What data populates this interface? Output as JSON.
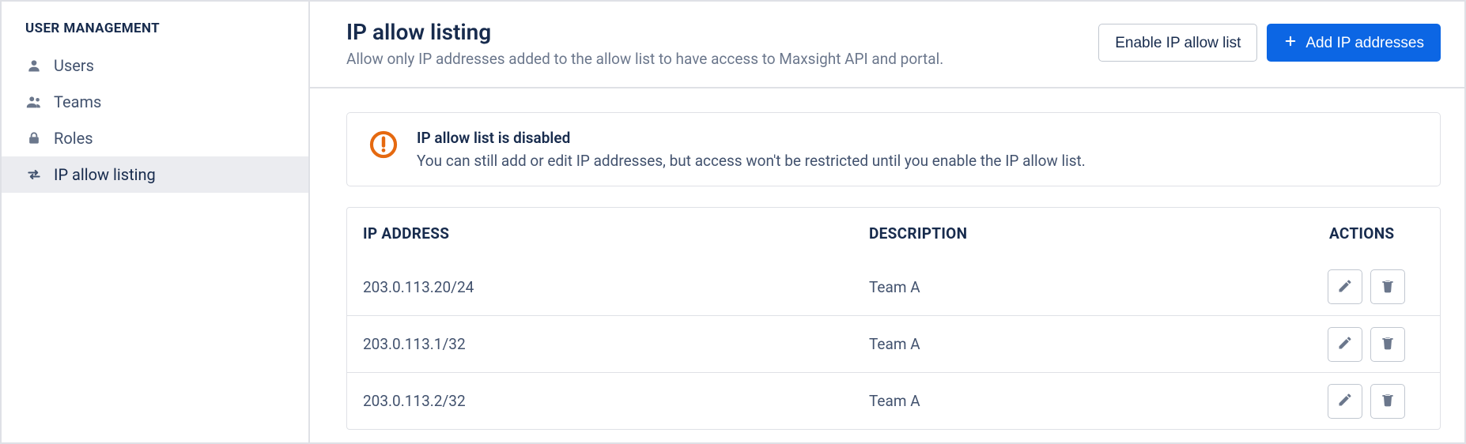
{
  "sidebar": {
    "title": "USER MANAGEMENT",
    "items": [
      {
        "label": "Users",
        "icon": "user"
      },
      {
        "label": "Teams",
        "icon": "team"
      },
      {
        "label": "Roles",
        "icon": "lock"
      },
      {
        "label": "IP allow listing",
        "icon": "swap"
      }
    ],
    "active_index": 3
  },
  "header": {
    "title": "IP allow listing",
    "subtitle": "Allow only IP addresses added to the allow list to have access to Maxsight API and portal.",
    "enable_button": "Enable IP allow list",
    "add_button": "Add IP addresses"
  },
  "alert": {
    "title": "IP allow list is disabled",
    "body": "You can still add or edit IP addresses, but access won't be restricted until you enable the IP allow list."
  },
  "table": {
    "columns": {
      "ip": "IP ADDRESS",
      "desc": "DESCRIPTION",
      "actions": "ACTIONS"
    },
    "rows": [
      {
        "ip": "203.0.113.20/24",
        "desc": "Team A"
      },
      {
        "ip": "203.0.113.1/32",
        "desc": "Team A"
      },
      {
        "ip": "203.0.113.2/32",
        "desc": "Team A"
      }
    ]
  },
  "colors": {
    "primary": "#0C66E4",
    "warning": "#E56910",
    "border": "#DFE1E6"
  }
}
